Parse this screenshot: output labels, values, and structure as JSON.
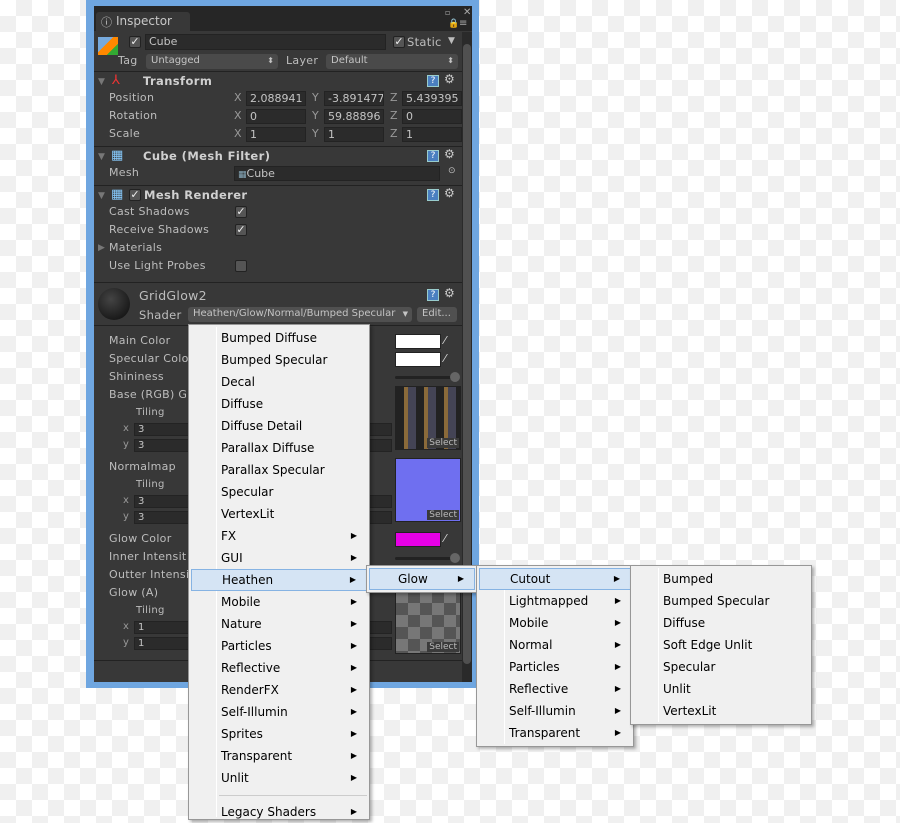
{
  "window": {
    "tab": "Inspector"
  },
  "object": {
    "active": true,
    "name": "Cube",
    "static_label": "Static",
    "static": true,
    "tag_label": "Tag",
    "tag": "Untagged",
    "layer_label": "Layer",
    "layer": "Default"
  },
  "transform": {
    "title": "Transform",
    "rows": [
      {
        "label": "Position",
        "x": "2.088941",
        "y": "-3.891477",
        "z": "5.439395"
      },
      {
        "label": "Rotation",
        "x": "0",
        "y": "59.88896",
        "z": "0"
      },
      {
        "label": "Scale",
        "x": "1",
        "y": "1",
        "z": "1"
      }
    ],
    "axes": [
      "X",
      "Y",
      "Z"
    ]
  },
  "mesh_filter": {
    "title": "Cube (Mesh Filter)",
    "mesh_label": "Mesh",
    "mesh": "Cube"
  },
  "mesh_renderer": {
    "title": "Mesh Renderer",
    "enabled": true,
    "cast_shadows": "Cast Shadows",
    "receive_shadows": "Receive Shadows",
    "materials": "Materials",
    "light_probes": "Use Light Probes",
    "cast_checked": true,
    "receive_checked": true,
    "probes_checked": false
  },
  "material": {
    "name": "GridGlow2",
    "shader_label": "Shader",
    "shader": "Heathen/Glow/Normal/Bumped Specular",
    "edit": "Edit...",
    "props": [
      "Main Color",
      "Specular Colo",
      "Shininess",
      "Base (RGB) G",
      "Normalmap",
      "Glow Color",
      "Inner Intensit",
      "Outter Intensi",
      "Glow (A)"
    ],
    "tiling_label": "Tiling",
    "x_label": "x",
    "y_label": "y",
    "tiling": [
      [
        "3",
        "3"
      ],
      [
        "3",
        "3"
      ],
      [
        "1",
        "1"
      ]
    ],
    "select": "Select",
    "glow_color": "#e600e6"
  },
  "menu1": {
    "items": [
      {
        "label": "Bumped Diffuse"
      },
      {
        "label": "Bumped Specular"
      },
      {
        "label": "Decal"
      },
      {
        "label": "Diffuse"
      },
      {
        "label": "Diffuse Detail"
      },
      {
        "label": "Parallax Diffuse"
      },
      {
        "label": "Parallax Specular"
      },
      {
        "label": "Specular"
      },
      {
        "label": "VertexLit"
      },
      {
        "label": "FX",
        "sub": true
      },
      {
        "label": "GUI",
        "sub": true
      },
      {
        "label": "Heathen",
        "sub": true,
        "selected": true
      },
      {
        "label": "Mobile",
        "sub": true
      },
      {
        "label": "Nature",
        "sub": true
      },
      {
        "label": "Particles",
        "sub": true
      },
      {
        "label": "Reflective",
        "sub": true
      },
      {
        "label": "RenderFX",
        "sub": true
      },
      {
        "label": "Self-Illumin",
        "sub": true
      },
      {
        "label": "Sprites",
        "sub": true
      },
      {
        "label": "Transparent",
        "sub": true
      },
      {
        "label": "Unlit",
        "sub": true
      }
    ],
    "legacy": "Legacy Shaders"
  },
  "menu2": {
    "items": [
      {
        "label": "Glow",
        "sub": true,
        "selected": true
      }
    ]
  },
  "menu3": {
    "items": [
      {
        "label": "Cutout",
        "sub": true,
        "selected": true
      },
      {
        "label": "Lightmapped",
        "sub": true
      },
      {
        "label": "Mobile",
        "sub": true
      },
      {
        "label": "Normal",
        "sub": true
      },
      {
        "label": "Particles",
        "sub": true
      },
      {
        "label": "Reflective",
        "sub": true
      },
      {
        "label": "Self-Illumin",
        "sub": true
      },
      {
        "label": "Transparent",
        "sub": true
      }
    ]
  },
  "menu4": {
    "items": [
      {
        "label": "Bumped"
      },
      {
        "label": "Bumped Specular"
      },
      {
        "label": "Diffuse"
      },
      {
        "label": "Soft Edge Unlit"
      },
      {
        "label": "Specular"
      },
      {
        "label": "Unlit"
      },
      {
        "label": "VertexLit"
      }
    ]
  }
}
